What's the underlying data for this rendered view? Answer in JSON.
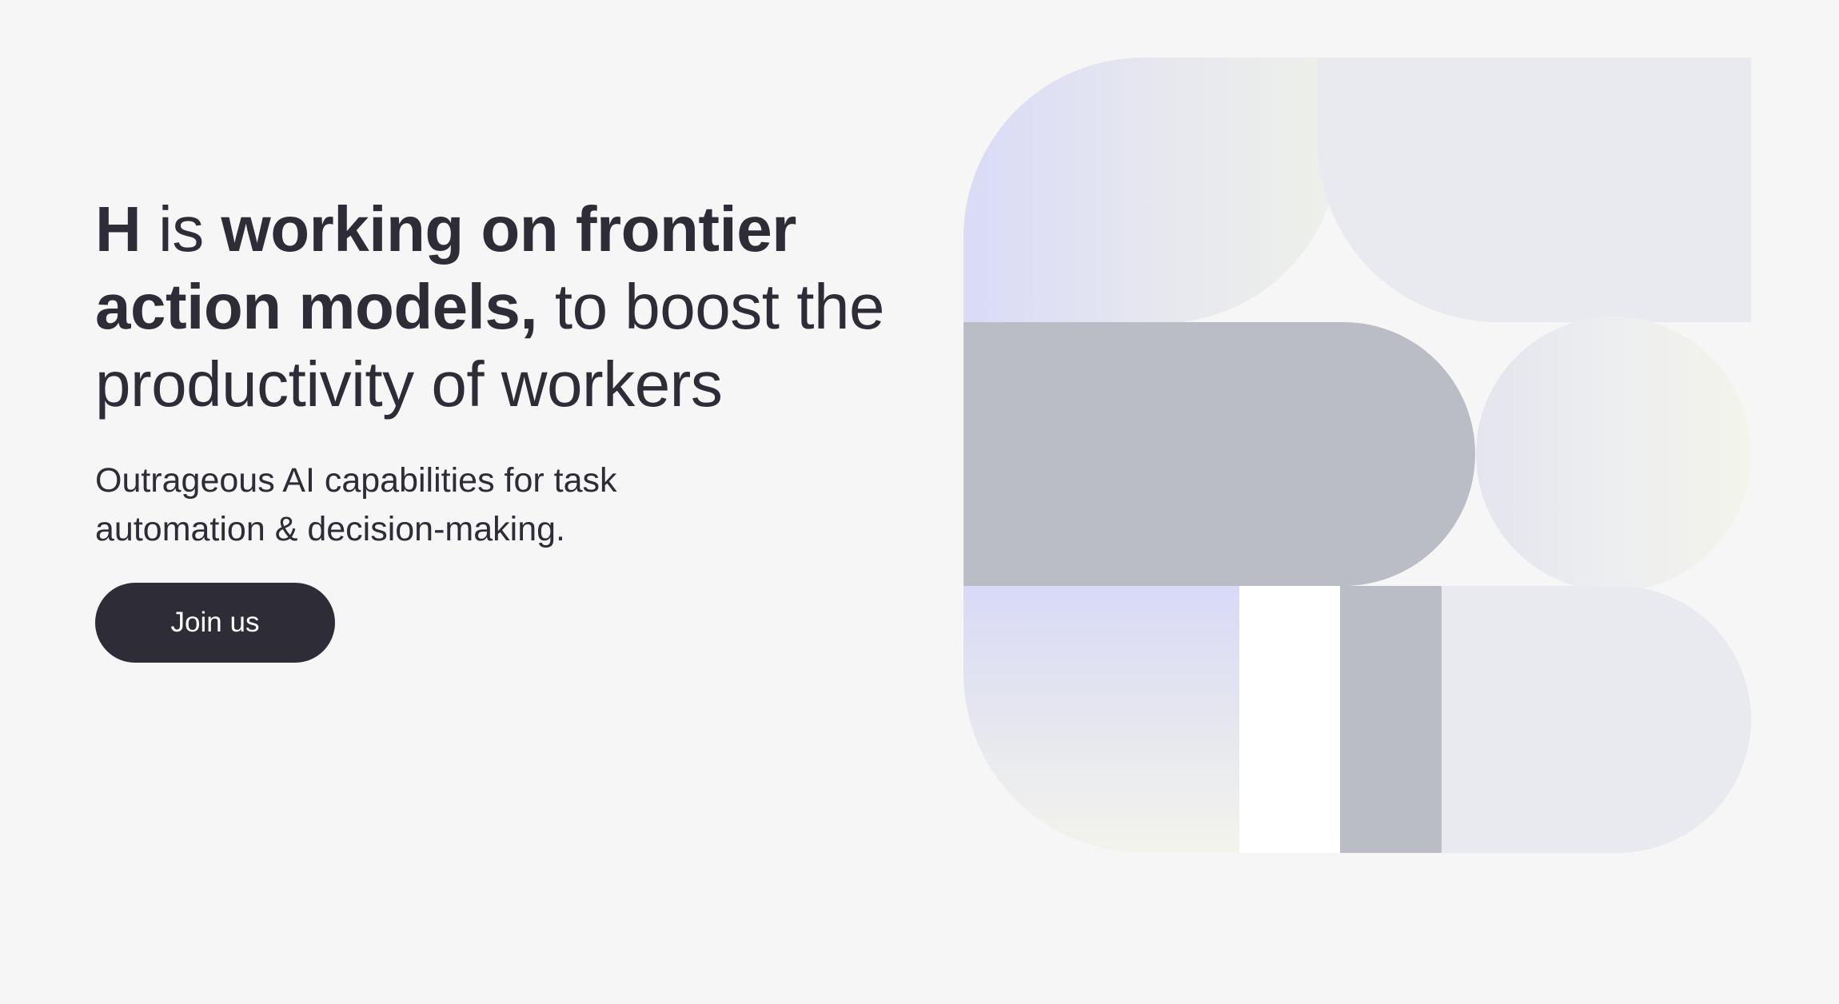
{
  "hero": {
    "headline": {
      "part1_bold": "H",
      "part2": " is ",
      "part3_bold": "working on frontier action models,",
      "part4": " to boost the productivity of workers"
    },
    "subtitle": "Outrageous AI capabilities for task automation & decision-making.",
    "cta_label": "Join us"
  },
  "colors": {
    "background": "#f6f6f6",
    "text": "#2e2c36",
    "button": "#2e2c36",
    "shape_gray": "#babcc6",
    "shape_light": "#e9eaef",
    "shape_lavender": "#d9dbf7",
    "shape_cream": "#f2f3ec"
  }
}
